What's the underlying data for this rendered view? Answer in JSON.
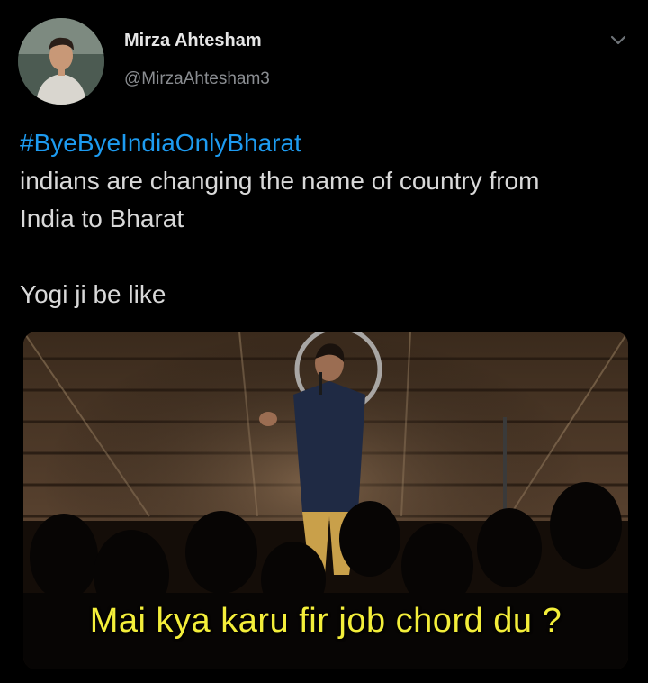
{
  "author": {
    "name": "Mirza Ahtesham",
    "handle": "@MirzaAhtesham3",
    "avatar_icon": "user-avatar-photo"
  },
  "menu_icon": "chevron-down-icon",
  "tweet": {
    "hashtag": "#ByeByeIndiaOnlyBharat",
    "line1": "indians are changing the name of country from",
    "line2": "India to Bharat",
    "line3": "Yogi ji be like"
  },
  "media": {
    "subtitle": "Mai kya karu fir job chord du ?"
  },
  "colors": {
    "background": "#000000",
    "text": "#d9d9d9",
    "handle": "#8a8d91",
    "hashtag": "#1d9bf0",
    "subtitle": "#f3ee3a"
  }
}
